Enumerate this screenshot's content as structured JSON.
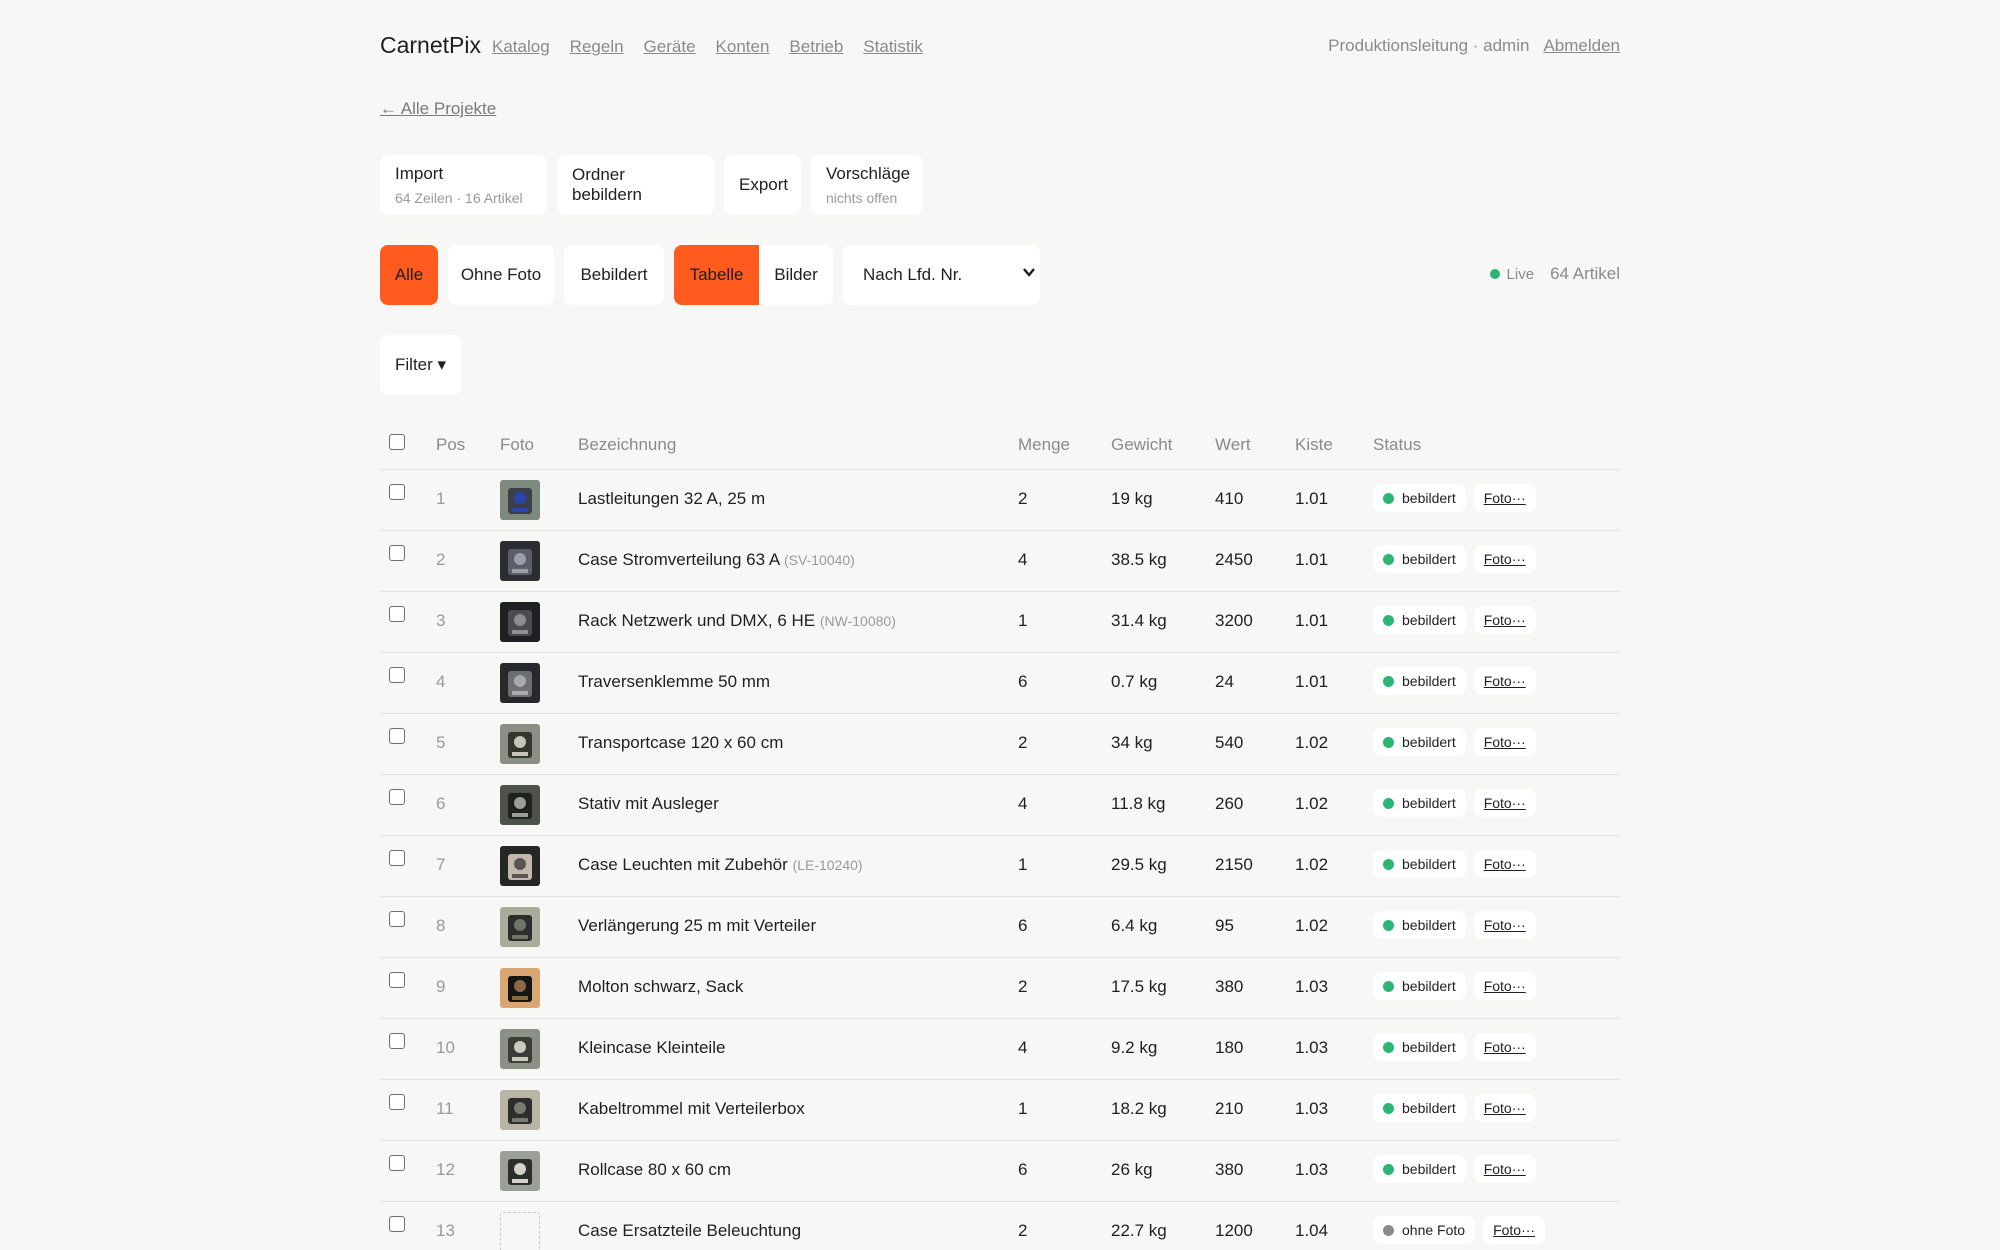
{
  "nav": {
    "brand": "CarnetPix",
    "links": [
      "Katalog",
      "Regeln",
      "Geräte",
      "Konten",
      "Betrieb",
      "Statistik"
    ],
    "user": "Produktionsleitung · admin",
    "logout": "Abmelden"
  },
  "back_link": "← Alle Projekte",
  "actions": [
    {
      "title": "Import",
      "sub": "64 Zeilen · 16 Artikel"
    },
    {
      "title": "Ordner bebildern",
      "sub": ""
    },
    {
      "title": "Export",
      "sub": ""
    },
    {
      "title": "Vorschläge",
      "sub": "nichts offen"
    }
  ],
  "filters": {
    "all": "Alle",
    "no_photo": "Ohne Foto",
    "with_photo": "Bebildert",
    "view_table": "Tabelle",
    "view_images": "Bilder",
    "sort": "Nach Lfd. Nr.",
    "live": "Live",
    "count": "64 Artikel",
    "filter_button": "Filter ▾",
    "active_filter": "Alle",
    "active_view": "Tabelle"
  },
  "table": {
    "headers": {
      "pos": "Pos",
      "photo": "Foto",
      "desc": "Bezeichnung",
      "qty": "Menge",
      "weight": "Gewicht",
      "value": "Wert",
      "box": "Kiste",
      "status": "Status"
    },
    "photo_button": "Foto···",
    "status_colors": {
      "bebildert": "#2bb673",
      "ohne Foto": "#8a8a8a"
    },
    "rows": [
      {
        "pos": "1",
        "desc": "Lastleitungen 32 A, 25 m",
        "art": "",
        "qty": "2",
        "weight": "19 kg",
        "value": "410",
        "box": "1.01",
        "status": "bebildert",
        "thumb": "cable-coil"
      },
      {
        "pos": "2",
        "desc": "Case Stromverteilung 63 A",
        "art": "(SV-10040)",
        "qty": "4",
        "weight": "38.5 kg",
        "value": "2450",
        "box": "1.01",
        "status": "bebildert",
        "thumb": "power-case"
      },
      {
        "pos": "3",
        "desc": "Rack Netzwerk und DMX, 6 HE",
        "art": "(NW-10080)",
        "qty": "1",
        "weight": "31.4 kg",
        "value": "3200",
        "box": "1.01",
        "status": "bebildert",
        "thumb": "rack"
      },
      {
        "pos": "4",
        "desc": "Traversenklemme 50 mm",
        "art": "",
        "qty": "6",
        "weight": "0.7 kg",
        "value": "24",
        "box": "1.01",
        "status": "bebildert",
        "thumb": "clamp"
      },
      {
        "pos": "5",
        "desc": "Transportcase 120 x 60 cm",
        "art": "",
        "qty": "2",
        "weight": "34 kg",
        "value": "540",
        "box": "1.02",
        "status": "bebildert",
        "thumb": "transport-case"
      },
      {
        "pos": "6",
        "desc": "Stativ mit Ausleger",
        "art": "",
        "qty": "4",
        "weight": "11.8 kg",
        "value": "260",
        "box": "1.02",
        "status": "bebildert",
        "thumb": "stand"
      },
      {
        "pos": "7",
        "desc": "Case Leuchten mit Zubehör",
        "art": "(LE-10240)",
        "qty": "1",
        "weight": "29.5 kg",
        "value": "2150",
        "box": "1.02",
        "status": "bebildert",
        "thumb": "light-case"
      },
      {
        "pos": "8",
        "desc": "Verlängerung 25 m mit Verteiler",
        "art": "",
        "qty": "6",
        "weight": "6.4 kg",
        "value": "95",
        "box": "1.02",
        "status": "bebildert",
        "thumb": "extension"
      },
      {
        "pos": "9",
        "desc": "Molton schwarz, Sack",
        "art": "",
        "qty": "2",
        "weight": "17.5 kg",
        "value": "380",
        "box": "1.03",
        "status": "bebildert",
        "thumb": "molton"
      },
      {
        "pos": "10",
        "desc": "Kleincase Kleinteile",
        "art": "",
        "qty": "4",
        "weight": "9.2 kg",
        "value": "180",
        "box": "1.03",
        "status": "bebildert",
        "thumb": "small-case"
      },
      {
        "pos": "11",
        "desc": "Kabeltrommel mit Verteilerbox",
        "art": "",
        "qty": "1",
        "weight": "18.2 kg",
        "value": "210",
        "box": "1.03",
        "status": "bebildert",
        "thumb": "cable-drum"
      },
      {
        "pos": "12",
        "desc": "Rollcase 80 x 60 cm",
        "art": "",
        "qty": "6",
        "weight": "26 kg",
        "value": "380",
        "box": "1.03",
        "status": "bebildert",
        "thumb": "roll-case"
      },
      {
        "pos": "13",
        "desc": "Case Ersatzteile Beleuchtung",
        "art": "",
        "qty": "2",
        "weight": "22.7 kg",
        "value": "1200",
        "box": "1.04",
        "status": "ohne Foto",
        "thumb": ""
      }
    ]
  }
}
